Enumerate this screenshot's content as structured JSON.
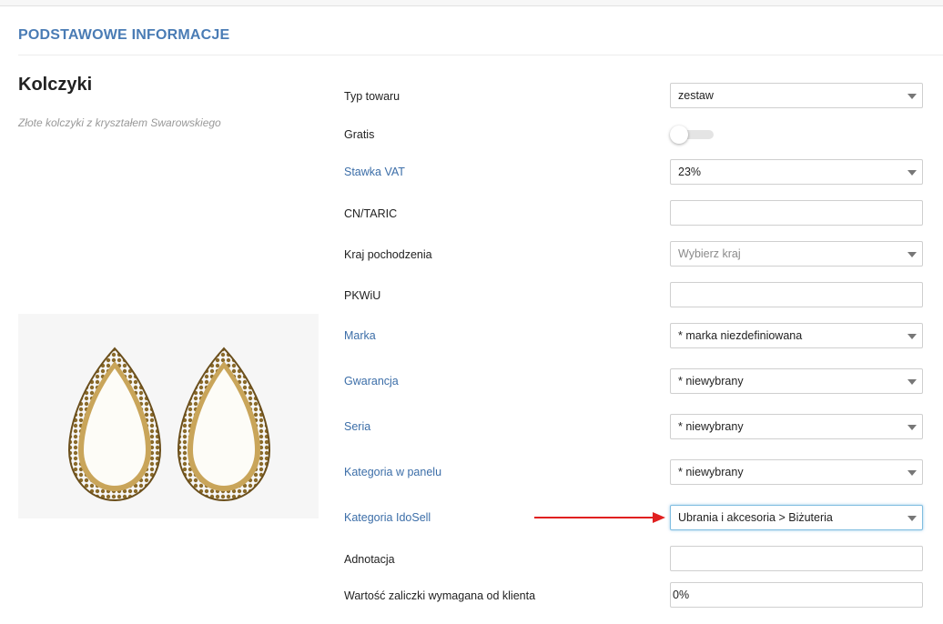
{
  "section": {
    "title": "PODSTAWOWE INFORMACJE"
  },
  "product": {
    "name": "Kolczyki",
    "description": "Złote kolczyki z kryształem Swarowskiego"
  },
  "fields": {
    "typ_towaru": {
      "label": "Typ towaru",
      "value": "zestaw"
    },
    "gratis": {
      "label": "Gratis",
      "value": false
    },
    "stawka_vat": {
      "label": "Stawka VAT",
      "value": "23%"
    },
    "cn_taric": {
      "label": "CN/TARIC",
      "value": ""
    },
    "kraj": {
      "label": "Kraj pochodzenia",
      "placeholder": "Wybierz kraj"
    },
    "pkwiu": {
      "label": "PKWiU",
      "value": ""
    },
    "marka": {
      "label": "Marka",
      "value": "* marka niezdefiniowana"
    },
    "gwarancja": {
      "label": "Gwarancja",
      "value": "* niewybrany"
    },
    "seria": {
      "label": "Seria",
      "value": "* niewybrany"
    },
    "kategoria_panel": {
      "label": "Kategoria w panelu",
      "value": "* niewybrany"
    },
    "kategoria_idosell": {
      "label": "Kategoria IdoSell",
      "value": "Ubrania i akcesoria > Biżuteria"
    },
    "adnotacja": {
      "label": "Adnotacja",
      "value": ""
    },
    "zaliczka": {
      "label": "Wartość zaliczki wymagana od klienta",
      "value": "0%"
    }
  },
  "colors": {
    "accent": "#4a7cb5",
    "link": "#3c6ea8",
    "arrow": "#e02020",
    "highlight": "#7fbde0"
  }
}
